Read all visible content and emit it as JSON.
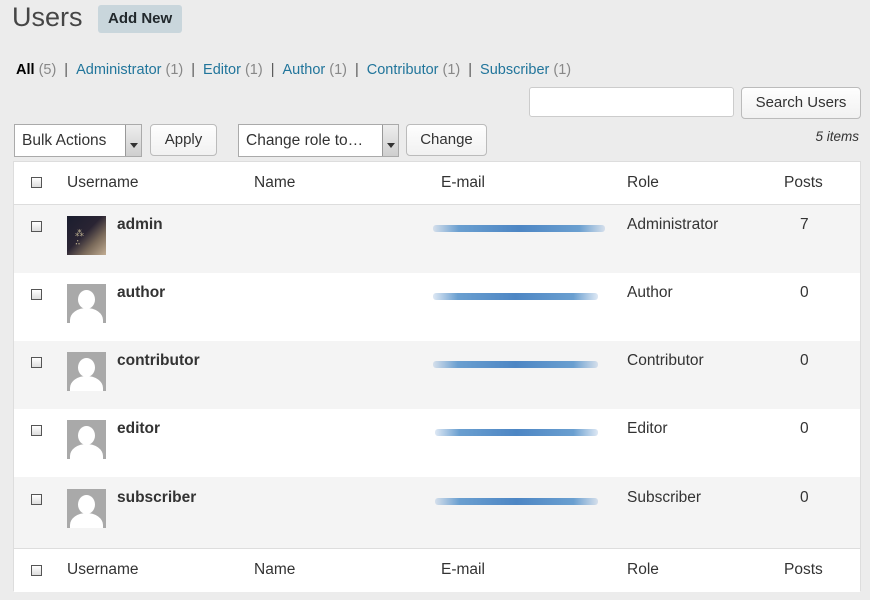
{
  "page": {
    "title": "Users",
    "add_new": "Add New"
  },
  "filters": [
    {
      "label": "All",
      "count": "(5)",
      "current": true
    },
    {
      "label": "Administrator",
      "count": "(1)"
    },
    {
      "label": "Editor",
      "count": "(1)"
    },
    {
      "label": "Author",
      "count": "(1)"
    },
    {
      "label": "Contributor",
      "count": "(1)"
    },
    {
      "label": "Subscriber",
      "count": "(1)"
    }
  ],
  "filter_separator": "|",
  "search": {
    "value": "",
    "button": "Search Users"
  },
  "bulk": {
    "selected": "Bulk Actions",
    "apply": "Apply"
  },
  "role_change": {
    "selected": "Change role to…",
    "button": "Change"
  },
  "items_count": "5 items",
  "columns": {
    "username": "Username",
    "name": "Name",
    "email": "E-mail",
    "role": "Role",
    "posts": "Posts"
  },
  "users": [
    {
      "username": "admin",
      "role": "Administrator",
      "posts": "7",
      "avatar": "photo"
    },
    {
      "username": "author",
      "role": "Author",
      "posts": "0",
      "avatar": "default"
    },
    {
      "username": "contributor",
      "role": "Contributor",
      "posts": "0",
      "avatar": "default"
    },
    {
      "username": "editor",
      "role": "Editor",
      "posts": "0",
      "avatar": "default"
    },
    {
      "username": "subscriber",
      "role": "Subscriber",
      "posts": "0",
      "avatar": "default"
    }
  ]
}
